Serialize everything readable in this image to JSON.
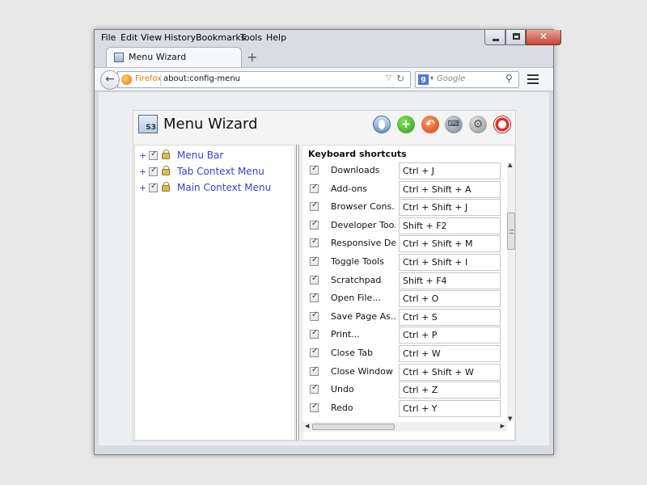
{
  "menubar": [
    "File",
    "Edit",
    "View",
    "History",
    "Bookmarks",
    "Tools",
    "Help"
  ],
  "window_controls": {
    "close": "✕"
  },
  "tab": {
    "title": "Menu Wizard",
    "new_tab": "+"
  },
  "navbar": {
    "identity": "Firefox",
    "url": "about:config-menu",
    "search_engine": "g",
    "search_placeholder": "Google"
  },
  "app": {
    "title": "Menu Wizard",
    "logo_text": "S3",
    "toolbar_icons": [
      "info-icon",
      "add-icon",
      "undo-icon",
      "keyboard-icon",
      "settings-icon",
      "help-icon"
    ]
  },
  "tree": {
    "items": [
      {
        "label": "Menu Bar",
        "checked": true
      },
      {
        "label": "Tab Context Menu",
        "checked": true
      },
      {
        "label": "Main Context Menu",
        "checked": true
      }
    ]
  },
  "shortcuts": {
    "heading": "Keyboard shortcuts",
    "rows": [
      {
        "label": "Downloads",
        "key": "Ctrl + J",
        "checked": true
      },
      {
        "label": "Add-ons",
        "key": "Ctrl + Shift + A",
        "checked": true
      },
      {
        "label": "Browser Cons...",
        "key": "Ctrl + Shift + J",
        "checked": true
      },
      {
        "label": "Developer Too...",
        "key": "Shift + F2",
        "checked": true
      },
      {
        "label": "Responsive De...",
        "key": "Ctrl + Shift + M",
        "checked": true
      },
      {
        "label": "Toggle Tools",
        "key": "Ctrl + Shift + I",
        "checked": true
      },
      {
        "label": "Scratchpad",
        "key": "Shift + F4",
        "checked": true
      },
      {
        "label": "Open File...",
        "key": "Ctrl + O",
        "checked": true
      },
      {
        "label": "Save Page As...",
        "key": "Ctrl + S",
        "checked": true
      },
      {
        "label": "Print...",
        "key": "Ctrl + P",
        "checked": true
      },
      {
        "label": "Close Tab",
        "key": "Ctrl + W",
        "checked": true
      },
      {
        "label": "Close Window",
        "key": "Ctrl + Shift + W",
        "checked": true
      },
      {
        "label": "Undo",
        "key": "Ctrl + Z",
        "checked": true
      },
      {
        "label": "Redo",
        "key": "Ctrl + Y",
        "checked": true
      }
    ]
  }
}
